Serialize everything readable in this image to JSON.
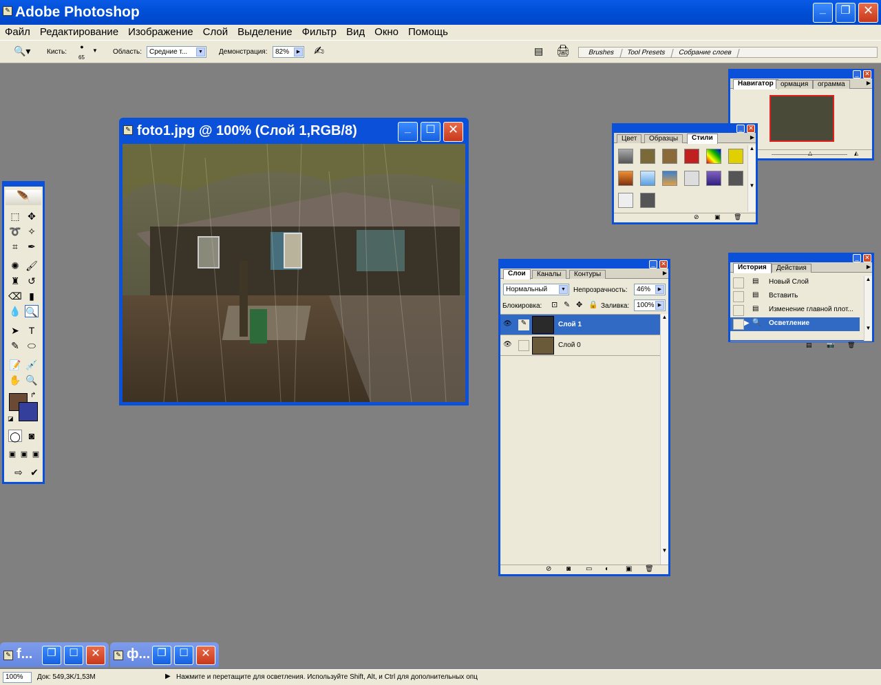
{
  "app": {
    "title": "Adobe Photoshop"
  },
  "menu": [
    "Файл",
    "Редактирование",
    "Изображение",
    "Слой",
    "Выделение",
    "Фильтр",
    "Вид",
    "Окно",
    "Помощь"
  ],
  "options": {
    "brush_label": "Кисть:",
    "brush_size": "65",
    "area_label": "Область:",
    "area_value": "Средние т...",
    "exposure_label": "Демонстрация:",
    "exposure_value": "82%",
    "well_tabs": [
      "Brushes",
      "Tool Presets",
      "Собрание слоев"
    ]
  },
  "document": {
    "title": "foto1.jpg @ 100% (Слой 1,RGB/8)"
  },
  "navigator": {
    "tabs": [
      "Навигатор",
      "ормация",
      "ограмма"
    ]
  },
  "styles": {
    "tabs": [
      "Цвет",
      "Образцы",
      "Стили"
    ]
  },
  "layers": {
    "tabs": [
      "Слои",
      "Каналы",
      "Контуры"
    ],
    "blend_mode": "Нормальный",
    "opacity_label": "Непрозрачность:",
    "opacity_value": "46%",
    "lock_label": "Блокировка:",
    "fill_label": "Заливка:",
    "fill_value": "100%",
    "rows": [
      {
        "name": "Слой 1",
        "selected": true
      },
      {
        "name": "Слой 0",
        "selected": false
      }
    ]
  },
  "history": {
    "tabs": [
      "История",
      "Действия"
    ],
    "items": [
      {
        "label": "Новый Слой",
        "selected": false
      },
      {
        "label": "Вставить",
        "selected": false
      },
      {
        "label": "Изменение главной плот...",
        "selected": false
      },
      {
        "label": "Осветление",
        "selected": true
      }
    ]
  },
  "minimized": [
    {
      "title": "f..."
    },
    {
      "title": "ф..."
    }
  ],
  "status": {
    "zoom": "100%",
    "doc": "Док: 549,3K/1,53M",
    "hint": "Нажмите и перетащите для осветления. Используйте Shift, Alt, и Ctrl для дополнительных опц"
  },
  "colors": {
    "titlebar": "#0050d8",
    "foreground": "#6b4a35",
    "background": "#343f9c",
    "selection": "#316ac5"
  }
}
